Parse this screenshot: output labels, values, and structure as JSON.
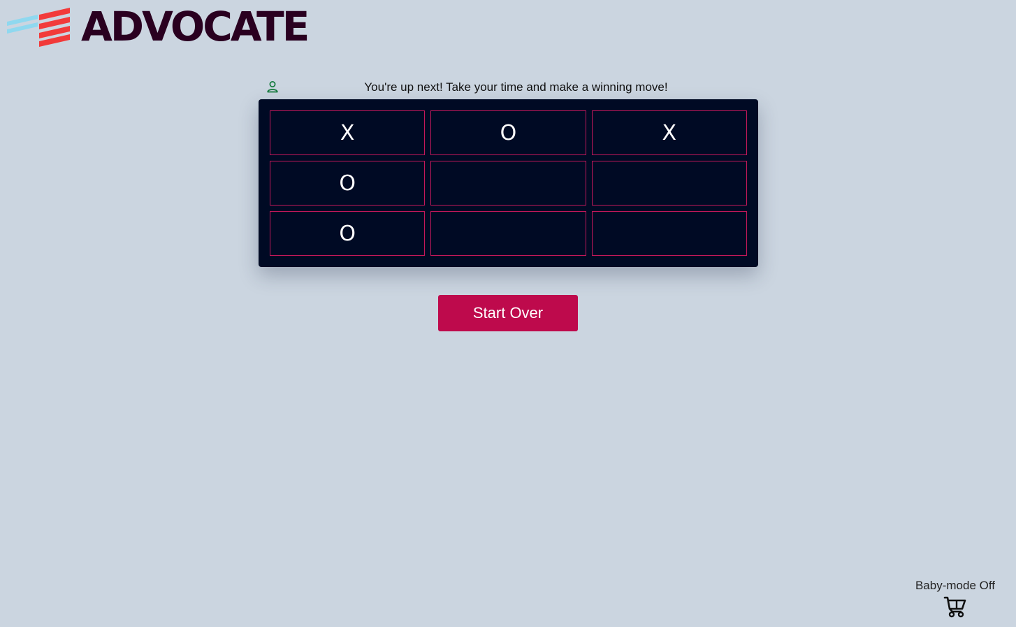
{
  "brand": {
    "name": "ADVOCATE",
    "logo_icon": "stripes-logo-icon",
    "colors": {
      "text": "#2a0020",
      "stripe_red": "#f23a3a",
      "stripe_blue": "#8fd8ef"
    }
  },
  "status": {
    "icon": "user-icon",
    "message": "You're up next! Take your time and make a winning move!"
  },
  "board": {
    "cells": [
      "X",
      "O",
      "X",
      "O",
      "",
      "",
      "O",
      "",
      ""
    ],
    "colors": {
      "background": "#000a24",
      "border": "#c2185b",
      "mark": "#ffffff"
    }
  },
  "controls": {
    "start_over_label": "Start Over",
    "button_color": "#be0a4c"
  },
  "baby_mode": {
    "label": "Baby-mode Off",
    "icon": "stroller-icon"
  }
}
